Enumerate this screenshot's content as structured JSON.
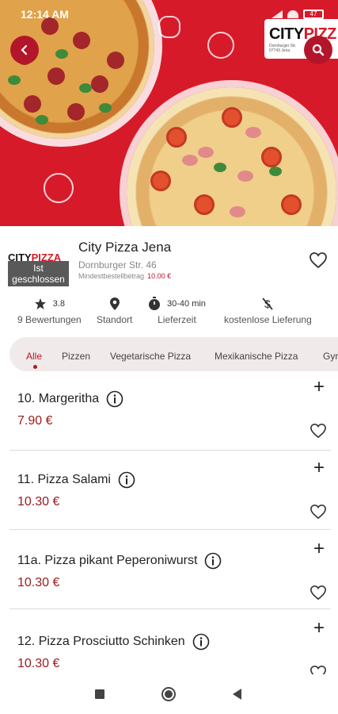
{
  "status_bar": {
    "time": "12:14 AM",
    "battery": "47"
  },
  "hero_logo": {
    "text_city": "CITY",
    "text_pizza": "PIZZ",
    "address_line1": "Dornburger Str.",
    "address_line2": "07743 Jena"
  },
  "restaurant": {
    "logo_text_city": "CITY",
    "logo_text_pizza": "PIZZA",
    "closed_label": "Ist geschlossen",
    "name": "City Pizza Jena",
    "address": "Dornburger Str. 46",
    "min_order_label": "Mindestbestellbetrag",
    "min_order_value": "10.00 €"
  },
  "stats": {
    "rating": "3.8",
    "reviews": "9 Bewertungen",
    "location": "Standort",
    "time": "30-40 min",
    "time_label": "Lieferzeit",
    "delivery": "kostenlose Lieferung"
  },
  "tabs": [
    "Alle",
    "Pizzen",
    "Vegetarische Pizza",
    "Mexikanische Pizza",
    "Gyr"
  ],
  "menu_items": [
    {
      "name": "10. Margeritha",
      "price": "7.90 €"
    },
    {
      "name": "11. Pizza Salami",
      "price": "10.30 €"
    },
    {
      "name": "11a. Pizza pikant Peperoniwurst",
      "price": "10.30 €"
    },
    {
      "name": "12. Pizza Prosciutto Schinken",
      "price": "10.30 €"
    }
  ],
  "colors": {
    "accent": "#d71a2a",
    "price": "#9b1a1a",
    "tab_bg": "#f1eaea"
  },
  "icons": {
    "back": "arrow-left-icon",
    "search": "search-icon",
    "favorite": "heart-icon",
    "rating": "star-icon",
    "location": "map-pin-icon",
    "time": "stopwatch-icon",
    "delivery": "no-delivery-fee-icon",
    "info": "info-icon",
    "add": "plus-icon"
  }
}
